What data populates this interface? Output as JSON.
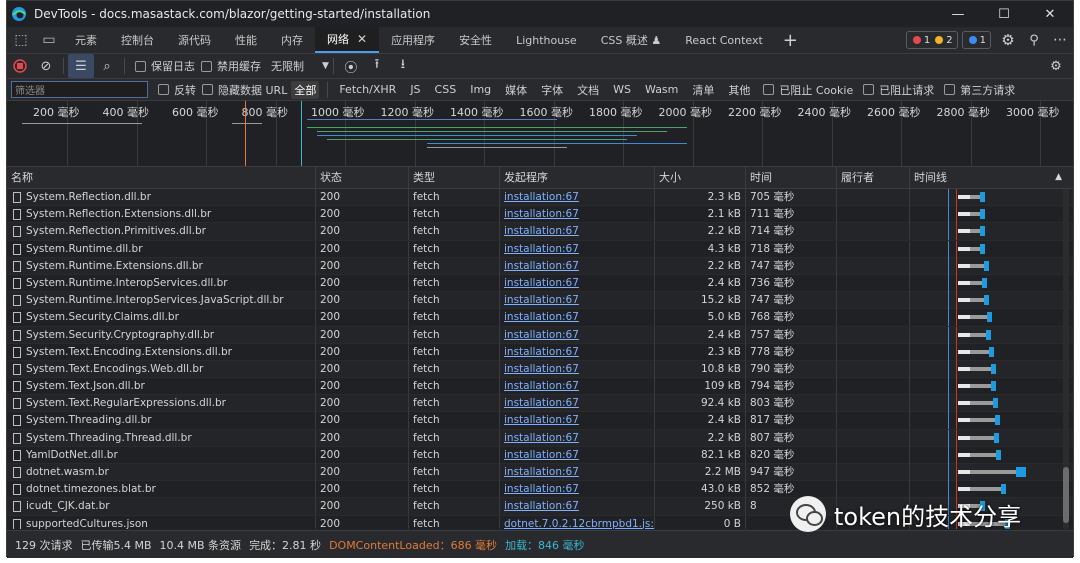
{
  "window": {
    "title": "DevTools - docs.masastack.com/blazor/getting-started/installation",
    "controls": [
      "—",
      "☐",
      "✕"
    ]
  },
  "tabs": [
    {
      "label": "元素"
    },
    {
      "label": "控制台"
    },
    {
      "label": "源代码"
    },
    {
      "label": "性能"
    },
    {
      "label": "内存"
    },
    {
      "label": "网络",
      "active": true
    },
    {
      "label": "应用程序"
    },
    {
      "label": "安全性"
    },
    {
      "label": "Lighthouse"
    },
    {
      "label": "CSS 概述 ♟"
    },
    {
      "label": "React Context"
    }
  ],
  "issues": {
    "errors": "1",
    "warnings": "2",
    "info": "1"
  },
  "toolbar": {
    "preserve_log": "保留日志",
    "disable_cache": "禁用缓存",
    "throttling": "无限制"
  },
  "filterbar": {
    "placeholder": "筛选器",
    "invert": "反转",
    "hide_data_urls": "隐藏数据 URL",
    "types": [
      "全部",
      "Fetch/XHR",
      "JS",
      "CSS",
      "Img",
      "媒体",
      "字体",
      "文档",
      "WS",
      "Wasm",
      "清单",
      "其他"
    ],
    "blocked_cookies": "已阻止 Cookie",
    "blocked_requests": "已阻止请求",
    "third_party": "第三方请求"
  },
  "overview": {
    "ticks": [
      "200 毫秒",
      "400 毫秒",
      "600 毫秒",
      "800 毫秒",
      "1000 毫秒",
      "1200 毫秒",
      "1400 毫秒",
      "1600 毫秒",
      "1800 毫秒",
      "2000 毫秒",
      "2200 毫秒",
      "2400 毫秒",
      "2600 毫秒",
      "2800 毫秒",
      "3000 毫秒"
    ]
  },
  "columns": {
    "name": "名称",
    "status": "状态",
    "type": "类型",
    "initiator": "发起程序",
    "size": "大小",
    "time": "时间",
    "fulfilled_by": "履行者",
    "waterfall": "时间线"
  },
  "rows": [
    {
      "name": "System.Reflection.dll.br",
      "status": "200",
      "type": "fetch",
      "initiator": "installation:67",
      "size": "2.3 kB",
      "time": "705 毫秒"
    },
    {
      "name": "System.Reflection.Extensions.dll.br",
      "status": "200",
      "type": "fetch",
      "initiator": "installation:67",
      "size": "2.1 kB",
      "time": "711 毫秒"
    },
    {
      "name": "System.Reflection.Primitives.dll.br",
      "status": "200",
      "type": "fetch",
      "initiator": "installation:67",
      "size": "2.2 kB",
      "time": "714 毫秒"
    },
    {
      "name": "System.Runtime.dll.br",
      "status": "200",
      "type": "fetch",
      "initiator": "installation:67",
      "size": "4.3 kB",
      "time": "718 毫秒"
    },
    {
      "name": "System.Runtime.Extensions.dll.br",
      "status": "200",
      "type": "fetch",
      "initiator": "installation:67",
      "size": "2.2 kB",
      "time": "747 毫秒"
    },
    {
      "name": "System.Runtime.InteropServices.dll.br",
      "status": "200",
      "type": "fetch",
      "initiator": "installation:67",
      "size": "2.4 kB",
      "time": "736 毫秒"
    },
    {
      "name": "System.Runtime.InteropServices.JavaScript.dll.br",
      "status": "200",
      "type": "fetch",
      "initiator": "installation:67",
      "size": "15.2 kB",
      "time": "747 毫秒"
    },
    {
      "name": "System.Security.Claims.dll.br",
      "status": "200",
      "type": "fetch",
      "initiator": "installation:67",
      "size": "5.0 kB",
      "time": "768 毫秒"
    },
    {
      "name": "System.Security.Cryptography.dll.br",
      "status": "200",
      "type": "fetch",
      "initiator": "installation:67",
      "size": "2.4 kB",
      "time": "757 毫秒"
    },
    {
      "name": "System.Text.Encoding.Extensions.dll.br",
      "status": "200",
      "type": "fetch",
      "initiator": "installation:67",
      "size": "2.3 kB",
      "time": "778 毫秒"
    },
    {
      "name": "System.Text.Encodings.Web.dll.br",
      "status": "200",
      "type": "fetch",
      "initiator": "installation:67",
      "size": "10.8 kB",
      "time": "790 毫秒"
    },
    {
      "name": "System.Text.Json.dll.br",
      "status": "200",
      "type": "fetch",
      "initiator": "installation:67",
      "size": "109 kB",
      "time": "794 毫秒"
    },
    {
      "name": "System.Text.RegularExpressions.dll.br",
      "status": "200",
      "type": "fetch",
      "initiator": "installation:67",
      "size": "92.4 kB",
      "time": "803 毫秒"
    },
    {
      "name": "System.Threading.dll.br",
      "status": "200",
      "type": "fetch",
      "initiator": "installation:67",
      "size": "2.4 kB",
      "time": "817 毫秒"
    },
    {
      "name": "System.Threading.Thread.dll.br",
      "status": "200",
      "type": "fetch",
      "initiator": "installation:67",
      "size": "2.2 kB",
      "time": "807 毫秒"
    },
    {
      "name": "YamlDotNet.dll.br",
      "status": "200",
      "type": "fetch",
      "initiator": "installation:67",
      "size": "82.1 kB",
      "time": "820 毫秒"
    },
    {
      "name": "dotnet.wasm.br",
      "status": "200",
      "type": "fetch",
      "initiator": "installation:67",
      "size": "2.2 MB",
      "time": "947 毫秒"
    },
    {
      "name": "dotnet.timezones.blat.br",
      "status": "200",
      "type": "fetch",
      "initiator": "installation:67",
      "size": "43.0 kB",
      "time": "852 毫秒"
    },
    {
      "name": "icudt_CJK.dat.br",
      "status": "200",
      "type": "fetch",
      "initiator": "installation:67",
      "size": "250 kB",
      "time": "8"
    },
    {
      "name": "supportedCultures.json",
      "status": "200",
      "type": "fetch",
      "initiator": "dotnet.7.0.2.12cbrmpbd1.js:5",
      "size": "0 B",
      "time": ""
    }
  ],
  "statusbar": {
    "requests": "129 次请求",
    "transferred": "已传输5.4 MB",
    "resources": "10.4 MB 条资源",
    "finish": "完成：2.81 秒",
    "dcl": "DOMContentLoaded：686 毫秒",
    "load": "加载：846 毫秒"
  },
  "watermark": {
    "text": "token的技术分享"
  },
  "colors": {
    "accent": "#4c9cf1",
    "dcl": "#e07b39",
    "load": "#3cb6d3",
    "waterfall_blue": "#1e9be0"
  }
}
